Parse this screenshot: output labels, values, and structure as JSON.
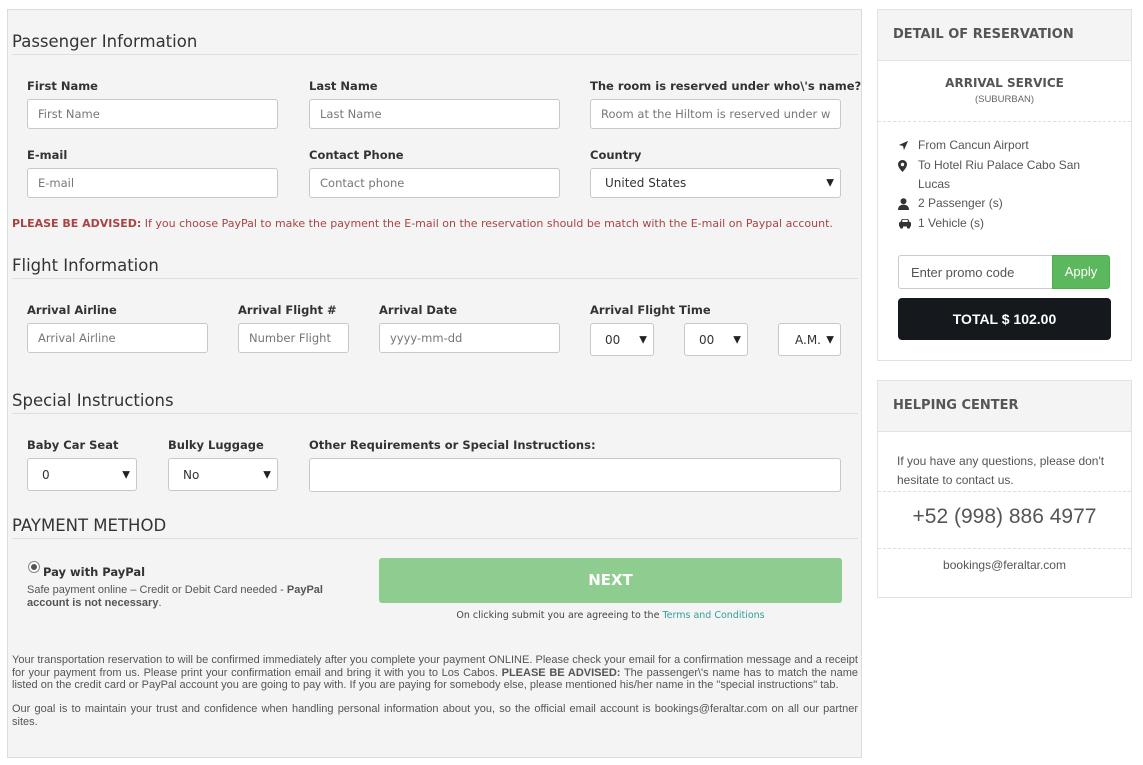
{
  "passenger": {
    "title": "Passenger Information",
    "first_name_label": "First Name",
    "first_name_placeholder": "First Name",
    "last_name_label": "Last Name",
    "last_name_placeholder": "Last Name",
    "room_label": "The room is reserved under who\\'s name?",
    "room_placeholder": "Room at the Hiltom is reserved under who\\'s name?",
    "email_label": "E-mail",
    "email_placeholder": "E-mail",
    "phone_label": "Contact Phone",
    "phone_placeholder": "Contact phone",
    "country_label": "Country",
    "country_value": "United States",
    "notice_bold": "PLEASE BE ADVISED:",
    "notice_text": " If you choose PayPal to make the payment the E-mail on the reservation should be match with the E-mail on Paypal account."
  },
  "flight": {
    "title": "Flight Information",
    "airline_label": "Arrival Airline",
    "airline_placeholder": "Arrival Airline",
    "flight_label": "Arrival Flight #",
    "flight_placeholder": "Number Flight",
    "date_label": "Arrival Date",
    "date_placeholder": "yyyy-mm-dd",
    "time_label": "Arrival Flight Time",
    "hour_value": "00",
    "minute_value": "00",
    "ampm_value": "A.M."
  },
  "special": {
    "title": "Special Instructions",
    "car_seat_label": "Baby Car Seat",
    "car_seat_value": "0",
    "luggage_label": "Bulky Luggage",
    "luggage_value": "No",
    "other_label": "Other Requirements or Special Instructions:"
  },
  "payment": {
    "title": "PAYMENT METHOD",
    "option_label": "Pay with PayPal",
    "desc_text": "Safe payment online – Credit or Debit Card needed - ",
    "desc_bold": "PayPal account is not necessary",
    "desc_end": ".",
    "next_label": "NEXT",
    "terms_prefix": "On clicking submit you are agreeing to the ",
    "terms_link": "Terms and Conditions"
  },
  "footer": {
    "p1_a": "Your transportation reservation to will be confirmed immediately after you complete your payment ONLINE. Please check your email for a confirmation message and a receipt for your payment from us. Please print your confirmation email and bring it with you to Los Cabos. ",
    "p1_bold": "PLEASE BE ADVISED:",
    "p1_b": " The passenger\\'s name has to match the name listed on the credit card or PayPal account you are going to pay with. If you are paying for somebody else, please mentioned his/her name in the \"special instructions\" tab.",
    "p2": "Our goal is to maintain your trust and confidence when handling personal information about you, so the official email account is bookings@feraltar.com on all our partner sites."
  },
  "reservation": {
    "title": "DETAIL OF RESERVATION",
    "service_name": "ARRIVAL SERVICE",
    "service_sub": "(SUBURBAN)",
    "from": "From Cancun Airport",
    "to": "To Hotel Riu Palace Cabo San Lucas",
    "passengers": "2 Passenger (s)",
    "vehicles": "1 Vehicle (s)",
    "promo_placeholder": "Enter promo code",
    "apply_label": "Apply",
    "total_label": "TOTAL $ 102.00"
  },
  "help": {
    "title": "HELPING CENTER",
    "text": "If you have any questions, please don't hesitate to contact us.",
    "phone": "+52 (998) 886 4977",
    "email": "bookings@feraltar.com"
  },
  "icons": [
    "location-arrow-icon",
    "map-marker-icon",
    "user-icon",
    "car-icon",
    "chevron-down-icon",
    "radio-selected-icon"
  ]
}
